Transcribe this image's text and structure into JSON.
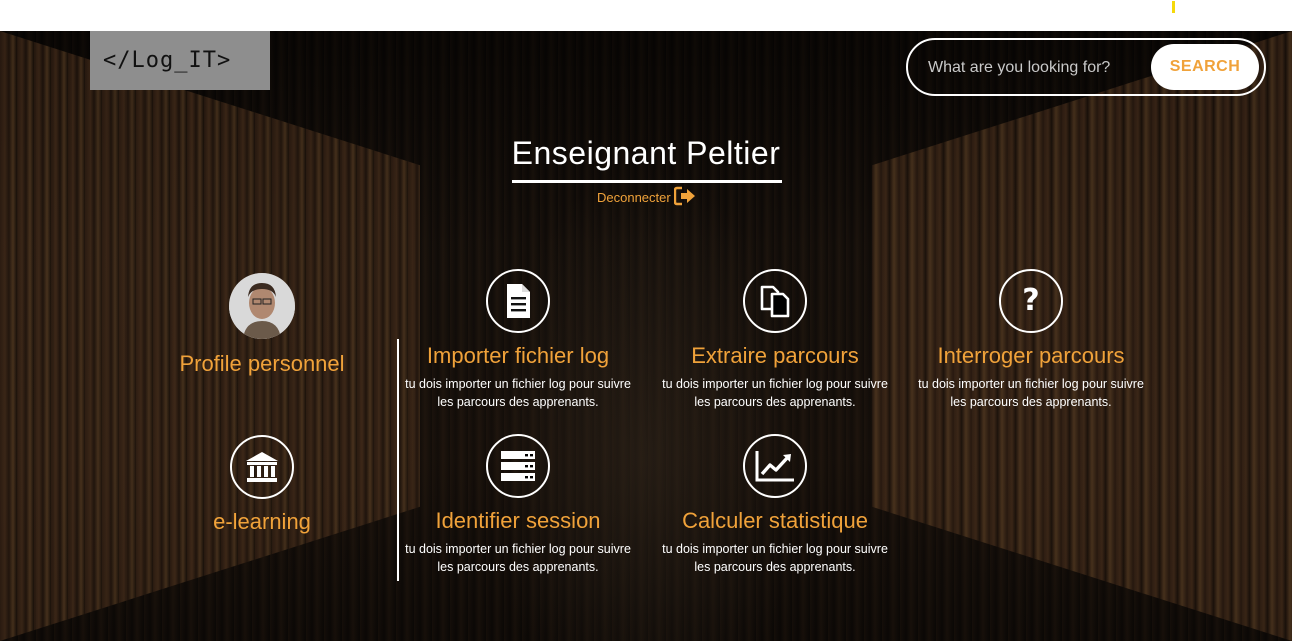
{
  "logo": {
    "text": "</Log_IT>"
  },
  "search": {
    "placeholder": "What are you looking for?",
    "button_label": "SEARCH"
  },
  "user": {
    "title": "Enseignant Peltier",
    "logout_label": "Deconnecter"
  },
  "colors": {
    "accent": "#f0a23a",
    "text": "#ffffff",
    "logo_bg": "#8e8e8e"
  },
  "sidebar": {
    "items": [
      {
        "label": "Profile personnel",
        "icon": "avatar"
      },
      {
        "label": "e-learning",
        "icon": "institution-icon"
      }
    ]
  },
  "features": [
    {
      "title": "Importer fichier log",
      "desc": "tu dois importer un fichier log pour suivre les parcours des apprenants.",
      "icon": "file-icon"
    },
    {
      "title": "Extraire parcours",
      "desc": "tu dois importer un fichier log pour suivre les parcours des apprenants.",
      "icon": "copy-icon"
    },
    {
      "title": "Interroger parcours",
      "desc": "tu dois importer un fichier log pour suivre les parcours des apprenants.",
      "icon": "question-icon"
    },
    {
      "title": "Identifier session",
      "desc": "tu dois importer un fichier log pour suivre les parcours des apprenants.",
      "icon": "server-icon"
    },
    {
      "title": "Calculer statistique",
      "desc": "tu dois importer un fichier log pour suivre les parcours des apprenants.",
      "icon": "line-chart-icon"
    }
  ]
}
